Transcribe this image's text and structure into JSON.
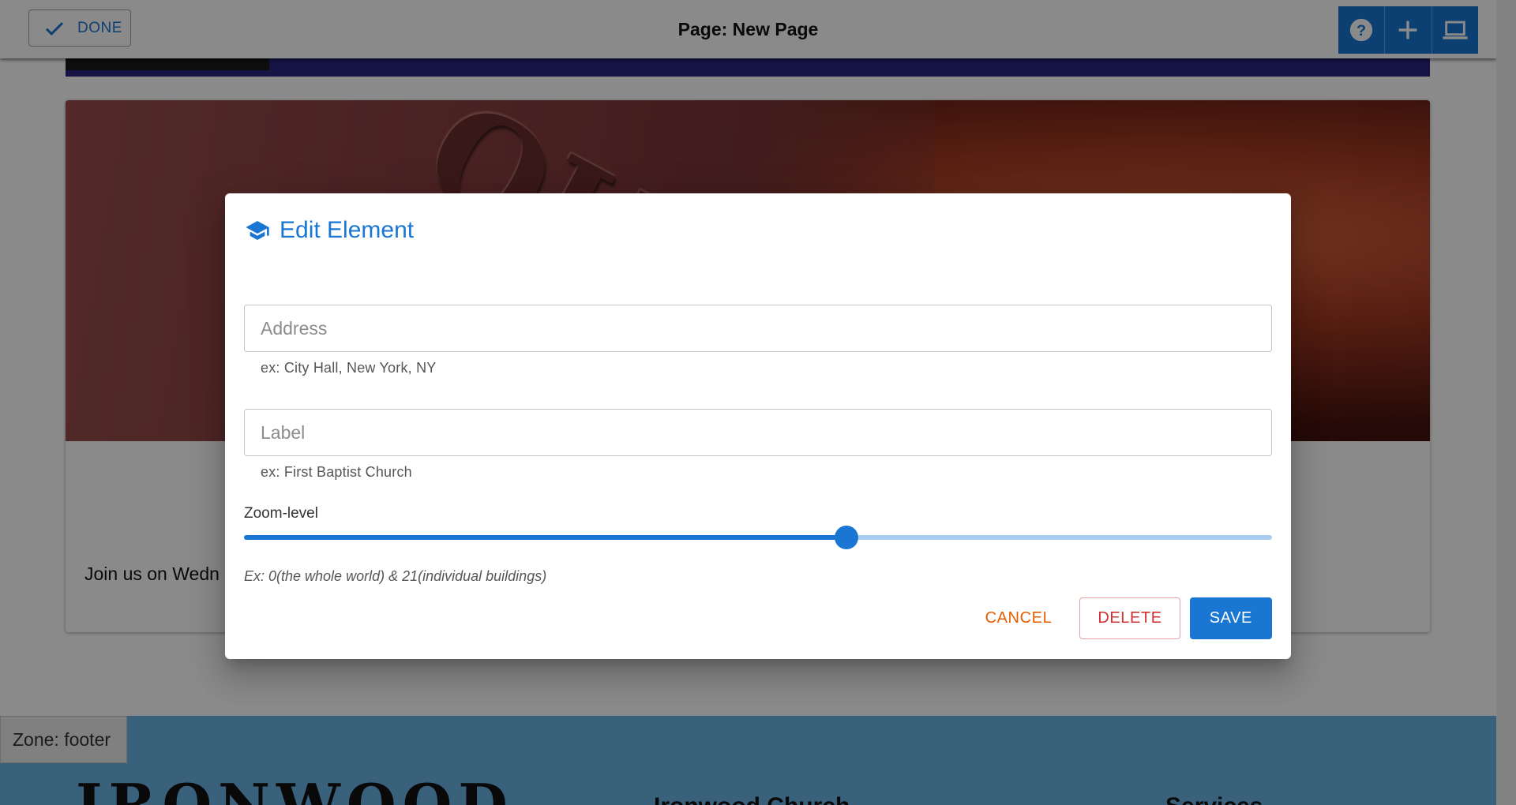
{
  "topbar": {
    "done_label": "DONE",
    "page_title": "Page: New Page",
    "tools": [
      "help-icon",
      "add-icon",
      "laptop-icon"
    ]
  },
  "page": {
    "join_text": "Join us on Wedn"
  },
  "footer": {
    "zone_label": "Zone: footer",
    "brand": "IRONWOOD",
    "col1_title": "Ironwood Church",
    "col2_title": "Services"
  },
  "dialog": {
    "title": "Edit Element",
    "title_icon": "graduation-cap-icon",
    "address": {
      "placeholder": "Address",
      "value": "",
      "helper": "ex: City Hall, New York, NY"
    },
    "label": {
      "placeholder": "Label",
      "value": "",
      "helper": "ex: First Baptist Church"
    },
    "zoom": {
      "label": "Zoom-level",
      "min": 0,
      "max": 21,
      "value": 12.3,
      "hint": "Ex: 0(the whole world) & 21(individual buildings)"
    },
    "actions": {
      "cancel": "CANCEL",
      "delete": "DELETE",
      "save": "SAVE"
    }
  },
  "colors": {
    "primary": "#1976d2",
    "cancel": "#e65c00",
    "delete": "#d32f2f",
    "footer_bg": "#6ab3e6"
  }
}
